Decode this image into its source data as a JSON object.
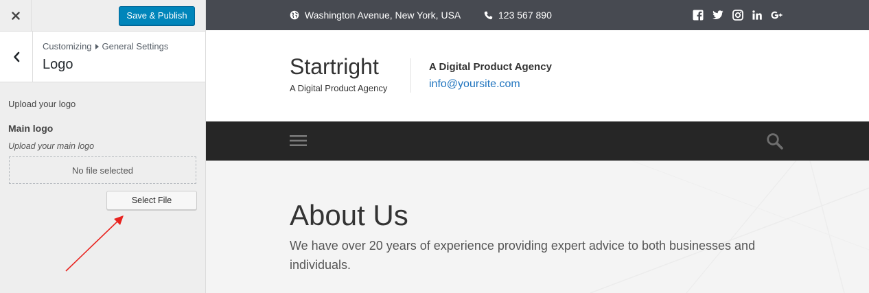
{
  "customizer": {
    "close_label": "×",
    "publish_label": "Save & Publish",
    "breadcrumb": {
      "root": "Customizing",
      "section": "General Settings"
    },
    "section_title": "Logo",
    "upload_description": "Upload your logo",
    "control": {
      "title": "Main logo",
      "description": "Upload your main logo",
      "placeholder": "No file selected",
      "select_label": "Select File"
    }
  },
  "site": {
    "topbar": {
      "address": "Washington Avenue, New York, USA",
      "phone": "123 567 890",
      "social_icons": [
        "facebook-icon",
        "twitter-icon",
        "instagram-icon",
        "linkedin-icon",
        "google-plus-icon"
      ]
    },
    "title": "Startright",
    "tagline": "A Digital Product Agency",
    "contact": {
      "heading": "A Digital Product Agency",
      "email": "info@yoursite.com"
    },
    "hero": {
      "title": "About Us",
      "text": "We have over 20 years of experience providing expert advice to both businesses and individuals."
    }
  },
  "colors": {
    "publish_button": "#0085ba",
    "topbar": "#474a51",
    "navbar": "#262626",
    "link": "#1e73be",
    "annotation_arrow": "#e8231f"
  }
}
